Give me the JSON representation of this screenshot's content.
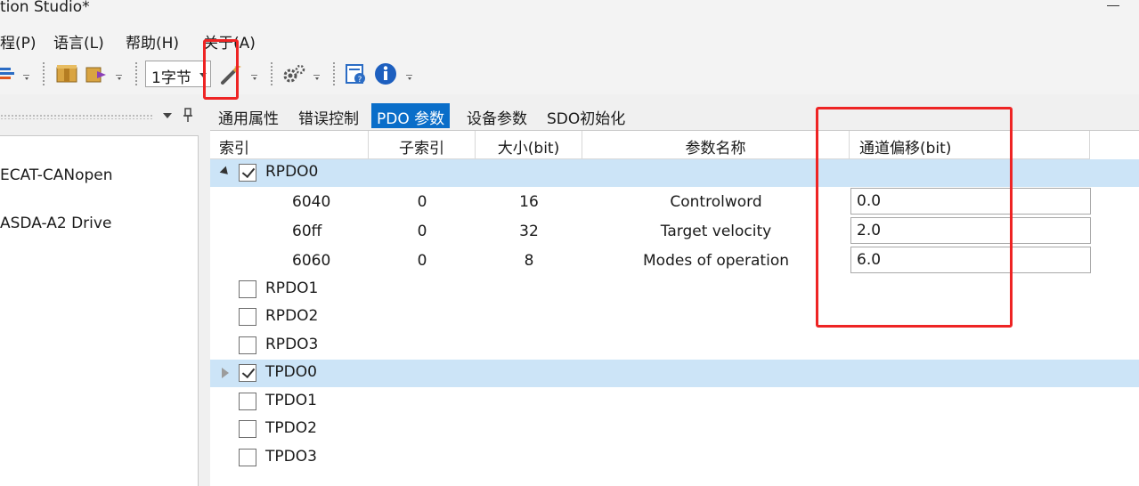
{
  "window": {
    "title": "tion Studio*"
  },
  "menu": {
    "items": [
      "程(P)",
      "语言(L)",
      "帮助(H)",
      "关于(A)"
    ]
  },
  "toolbar": {
    "byte_select": "1字节"
  },
  "left_tree": {
    "items": [
      "ECAT-CANopen",
      "ASDA-A2 Drive"
    ]
  },
  "tabs": [
    "通用属性",
    "错误控制",
    "PDO 参数",
    "设备参数",
    "SDO初始化"
  ],
  "active_tab": "PDO 参数",
  "grid": {
    "headers": [
      "索引",
      "子索引",
      "大小(bit)",
      "参数名称",
      "通道偏移(bit)"
    ],
    "groups": [
      {
        "name": "RPDO0",
        "checked": true,
        "expanded": true,
        "entries": [
          {
            "index": "6040",
            "subindex": "0",
            "size": "16",
            "name": "Controlword",
            "offset": "0.0"
          },
          {
            "index": "60ff",
            "subindex": "0",
            "size": "32",
            "name": "Target velocity",
            "offset": "2.0"
          },
          {
            "index": "6060",
            "subindex": "0",
            "size": "8",
            "name": "Modes of operation",
            "offset": "6.0"
          }
        ]
      },
      {
        "name": "RPDO1",
        "checked": false
      },
      {
        "name": "RPDO2",
        "checked": false
      },
      {
        "name": "RPDO3",
        "checked": false
      },
      {
        "name": "TPDO0",
        "checked": true,
        "expanded": false
      },
      {
        "name": "TPDO1",
        "checked": false
      },
      {
        "name": "TPDO2",
        "checked": false
      },
      {
        "name": "TPDO3",
        "checked": false
      }
    ]
  },
  "colors": {
    "selection": "#cce4f7",
    "active_tab": "#0a6ec9",
    "annotation": "#ee2424"
  }
}
